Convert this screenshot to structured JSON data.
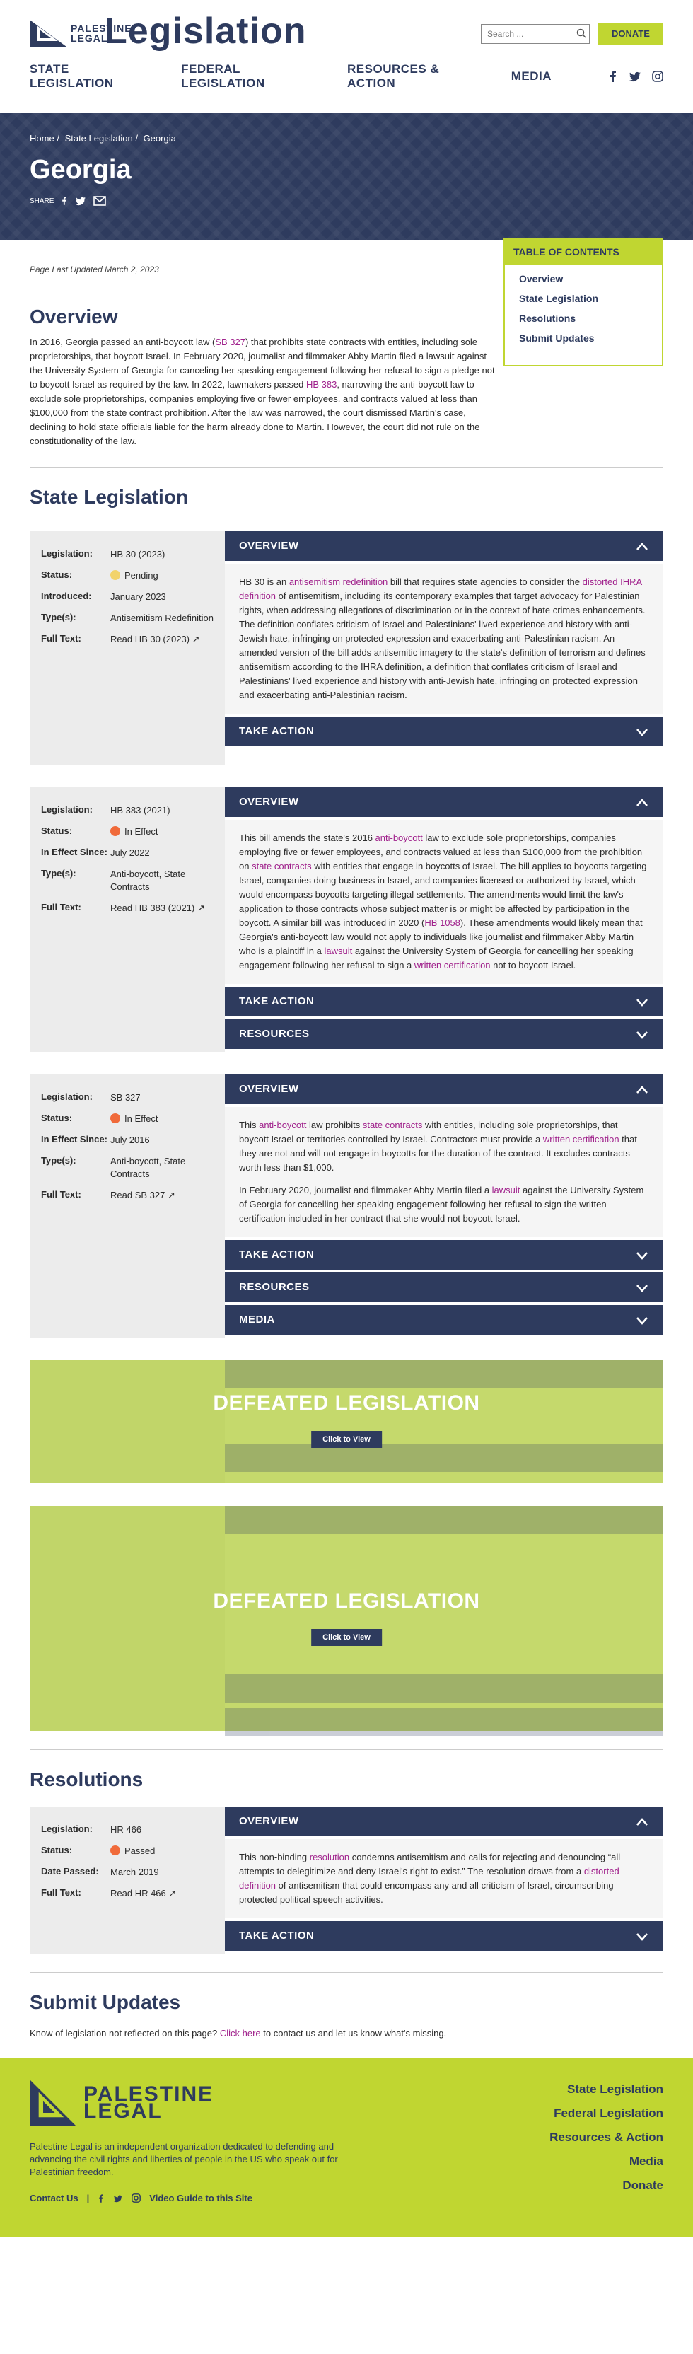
{
  "header": {
    "logo_text_1": "PALESTINE",
    "logo_text_2": "LEGAL",
    "title": "Legislation",
    "search_placeholder": "Search ...",
    "donate": "DONATE",
    "nav": [
      "STATE LEGISLATION",
      "FEDERAL LEGISLATION",
      "RESOURCES & ACTION",
      "MEDIA"
    ]
  },
  "hero": {
    "crumbs": [
      "Home",
      "/",
      "State Legislation",
      "/",
      "Georgia"
    ],
    "title": "Georgia",
    "share": "SHARE"
  },
  "updated": "Page Last Updated March 2, 2023",
  "toc": {
    "title": "TABLE OF CONTENTS",
    "items": [
      "Overview",
      "State Legislation",
      "Resolutions",
      "Submit Updates"
    ]
  },
  "overview": {
    "title": "Overview",
    "t1": "In 2016, Georgia passed an anti-boycott law (",
    "l1": "SB 327",
    "t2": ") that prohibits state contracts with entities, including sole proprietorships, that boycott Israel. In February 2020, journalist and filmmaker Abby Martin filed a lawsuit against the University System of Georgia for canceling her speaking engagement following her refusal to sign a pledge not to boycott Israel as required by the law. In 2022, lawmakers passed ",
    "l2": "HB 383",
    "t3": ", narrowing the anti-boycott law to exclude sole proprietorships, companies employing five or fewer employees, and contracts valued at less than $100,000 from the state contract prohibition. After the law was narrowed, the court dismissed Martin's case, declining to hold state officials liable for the harm already done to Martin. However, the court did not rule on the constitutionality of the law."
  },
  "state_title": "State Legislation",
  "labels": {
    "legislation": "Legislation:",
    "status": "Status:",
    "introduced": "Introduced:",
    "types": "Type(s):",
    "full_text": "Full Text:",
    "in_effect": "In Effect Since:",
    "date_passed": "Date Passed:"
  },
  "acc": {
    "overview": "OVERVIEW",
    "take_action": "TAKE ACTION",
    "resources": "RESOURCES",
    "media": "MEDIA"
  },
  "bill1": {
    "leg": "HB 30 (2023)",
    "status": "Pending",
    "date": "January 2023",
    "types": "Antisemitism Redefinition",
    "full": "Read HB 30 (2023)",
    "p": [
      "HB 30 is an ",
      "antisemitism redefinition",
      " bill that requires state agencies to consider the ",
      "distorted IHRA definition",
      " of antisemitism, including its contemporary examples that target advocacy for Palestinian rights, when addressing allegations of discrimination or in the context of hate crimes enhancements. The definition conflates criticism of Israel and Palestinians' lived experience and history with anti-Jewish hate, infringing on protected expression and exacerbating anti-Palestinian racism. An amended version of the bill adds antisemitic imagery to the state's definition of terrorism and defines antisemitism according to the IHRA definition, a definition that conflates criticism of Israel and Palestinians' lived experience and history with anti-Jewish hate, infringing on protected expression and exacerbating anti-Palestinian racism."
    ]
  },
  "bill2": {
    "leg": "HB 383 (2021)",
    "status": "In Effect",
    "date": "July 2022",
    "types": "Anti-boycott, State Contracts",
    "full": "Read HB 383 (2021)",
    "p": [
      "This bill amends the state's 2016 ",
      "anti-boycott",
      " law to exclude sole proprietorships, companies employing five or fewer employees, and contracts valued at less than $100,000 from the prohibition on ",
      "state contracts",
      " with entities that engage in boycotts of Israel. The bill applies to boycotts targeting Israel, companies doing business in Israel, and companies licensed or authorized by Israel, which would encompass boycotts targeting illegal settlements. The amendments would limit the law's application to those contracts whose subject matter is or might be affected by participation in the boycott. A similar bill was introduced in 2020 (",
      "HB 1058",
      "). These amendments would likely mean that Georgia's anti-boycott law would not apply to individuals like journalist and filmmaker Abby Martin who is a plaintiff in a ",
      "lawsuit",
      " against the University System of Georgia for cancelling her speaking engagement following her refusal to sign a ",
      "written certification",
      " not to boycott Israel."
    ]
  },
  "bill3": {
    "leg": "SB 327",
    "status": "In Effect",
    "date": "July 2016",
    "types": "Anti-boycott, State Contracts",
    "full": "Read SB 327",
    "p": [
      "This ",
      "anti-boycott",
      " law prohibits ",
      "state contracts",
      " with entities, including sole proprietorships, that boycott Israel or territories controlled by Israel. Contractors must provide a ",
      "written certification",
      " that they are not and will not engage in boycotts for the duration of the contract. It excludes contracts worth less than $1,000."
    ],
    "p2": [
      "In February 2020, journalist and filmmaker Abby Martin filed a ",
      "lawsuit",
      " against the University System of Georgia for cancelling her speaking engagement following her refusal to sign the written certification included in her contract that she would not boycott Israel."
    ]
  },
  "defeated": {
    "label": "DEFEATED LEGISLATION",
    "cta": "Click to View"
  },
  "resolutions_title": "Resolutions",
  "res1": {
    "leg": "HR 466",
    "status": "Passed",
    "date": "March 2019",
    "full": "Read HR 466",
    "p": [
      "This non-binding ",
      "resolution",
      " condemns antisemitism and calls for rejecting and denouncing “all attempts to delegitimize and deny Israel's right to exist.” The resolution draws from a ",
      "distorted definition",
      " of antisemitism that could encompass any and all criticism of Israel, circumscribing protected political speech activities."
    ]
  },
  "submit": {
    "title": "Submit Updates",
    "t1": "Know of legislation not reflected on this page? ",
    "link": "Click here",
    "t2": " to contact us and let us know what's missing."
  },
  "footer": {
    "logo1": "PALESTINE",
    "logo2": "LEGAL",
    "desc": "Palestine Legal is an independent organization dedicated to defending and advancing the civil rights and liberties of people in the US who speak out for Palestinian freedom.",
    "contact": "Contact Us",
    "sep": "|",
    "video": "Video Guide to this Site",
    "nav": [
      "State Legislation",
      "Federal Legislation",
      "Resources & Action",
      "Media",
      "Donate"
    ]
  },
  "colors": {
    "navy": "#2e3b5e",
    "lime": "#c0d631",
    "link": "#a0228c",
    "pending": "#f2d36b",
    "effect": "#f06a3a"
  }
}
